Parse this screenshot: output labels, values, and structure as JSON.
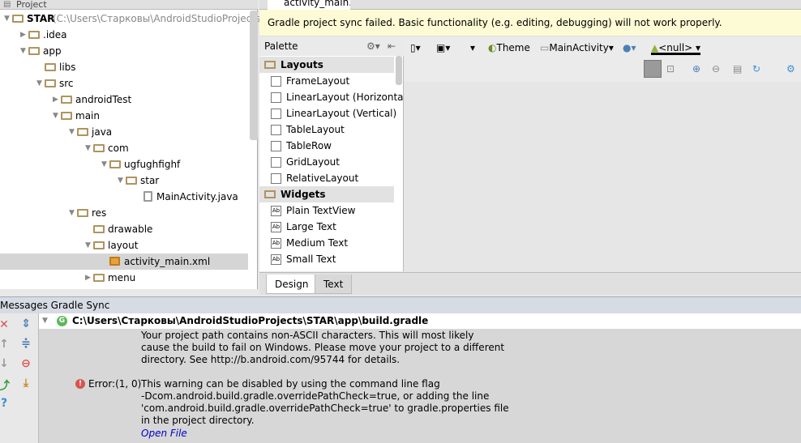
{
  "project": {
    "header": "Project",
    "tree": [
      {
        "label": "STAR",
        "hint": "(C:\\Users\\Старковы\\AndroidStudioProjects\\S",
        "depth": 0,
        "arrow": "down",
        "icon": "module-icon"
      },
      {
        "label": ".idea",
        "depth": 1,
        "arrow": "right",
        "icon": "folder-icon"
      },
      {
        "label": "app",
        "depth": 1,
        "arrow": "down",
        "icon": "folder-icon"
      },
      {
        "label": "libs",
        "depth": 2,
        "arrow": "",
        "icon": "folder-icon"
      },
      {
        "label": "src",
        "depth": 2,
        "arrow": "down",
        "icon": "folder-icon"
      },
      {
        "label": "androidTest",
        "depth": 3,
        "arrow": "right",
        "icon": "folder-icon"
      },
      {
        "label": "main",
        "depth": 3,
        "arrow": "down",
        "icon": "folder-icon"
      },
      {
        "label": "java",
        "depth": 4,
        "arrow": "down",
        "icon": "folder-icon"
      },
      {
        "label": "com",
        "depth": 5,
        "arrow": "down",
        "icon": "folder-icon"
      },
      {
        "label": "ugfughfighf",
        "depth": 6,
        "arrow": "down",
        "icon": "folder-icon"
      },
      {
        "label": "star",
        "depth": 7,
        "arrow": "down",
        "icon": "folder-icon"
      },
      {
        "label": "MainActivity.java",
        "depth": 8,
        "arrow": "",
        "icon": "java-class-icon"
      },
      {
        "label": "res",
        "depth": 4,
        "arrow": "down",
        "icon": "folder-icon"
      },
      {
        "label": "drawable",
        "depth": 5,
        "arrow": "",
        "icon": "folder-icon"
      },
      {
        "label": "layout",
        "depth": 5,
        "arrow": "down",
        "icon": "folder-icon"
      },
      {
        "label": "activity_main.xml",
        "depth": 6,
        "arrow": "",
        "icon": "xml-file-icon",
        "selected": true
      },
      {
        "label": "menu",
        "depth": 5,
        "arrow": "right",
        "icon": "folder-icon"
      }
    ]
  },
  "editor": {
    "tab": "activity_main.xml",
    "banner": "Gradle project sync failed. Basic functionality (e.g. editing, debugging) will not work properly."
  },
  "palette": {
    "title": "Palette",
    "items": [
      {
        "label": "Layouts",
        "category": true
      },
      {
        "label": "FrameLayout"
      },
      {
        "label": "LinearLayout (Horizontal)"
      },
      {
        "label": "LinearLayout (Vertical)"
      },
      {
        "label": "TableLayout"
      },
      {
        "label": "TableRow"
      },
      {
        "label": "GridLayout"
      },
      {
        "label": "RelativeLayout"
      },
      {
        "label": "Widgets",
        "category": true
      },
      {
        "label": "Plain TextView",
        "ab": "Ab"
      },
      {
        "label": "Large Text",
        "ab": "Ab"
      },
      {
        "label": "Medium Text",
        "ab": "Ab"
      },
      {
        "label": "Small Text",
        "ab": "Ab"
      }
    ]
  },
  "toolbar": {
    "theme": "Theme",
    "activity": "MainActivity",
    "api": "<null>"
  },
  "design_tabs": {
    "design": "Design",
    "text": "Text"
  },
  "messages": {
    "header": "Messages Gradle Sync",
    "file": "C:\\Users\\Старковы\\AndroidStudioProjects\\STAR\\app\\build.gradle",
    "lines1": [
      "Your project path contains non-ASCII characters. This will most likely",
      "cause the build to fail on Windows. Please move your project to a different",
      "directory. See http://b.android.com/95744 for details."
    ],
    "error_label": "Error:(1, 0)",
    "lines2": [
      "This warning can be disabled by using the command line flag",
      "-Dcom.android.build.gradle.overridePathCheck=true, or adding the line",
      "'com.android.build.gradle.overridePathCheck=true' to gradle.properties file",
      "in the project directory."
    ],
    "link": "Open File"
  },
  "colors": {
    "banner": "#fdfbd5",
    "selection": "#d5d5d5",
    "folder": "#b0935e",
    "error": "#d9534f",
    "android": "#8cb53a"
  }
}
